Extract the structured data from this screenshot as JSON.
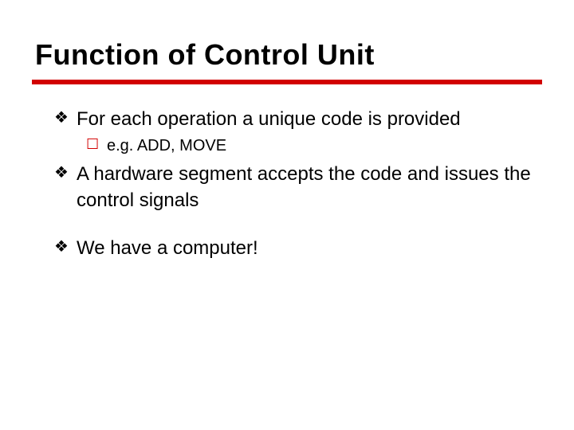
{
  "title": "Function of Control Unit",
  "bullets": [
    {
      "text": "For each operation a unique code is provided",
      "sub": [
        {
          "text": "e.g. ADD, MOVE"
        }
      ]
    },
    {
      "text": "A hardware segment accepts the code and issues the control signals"
    },
    {
      "text": "We have a computer!",
      "spaced": true
    }
  ],
  "glyphs": {
    "main": "❖",
    "sub": "☐"
  },
  "colors": {
    "rule": "#d20000",
    "sub_glyph": "#d20000"
  }
}
